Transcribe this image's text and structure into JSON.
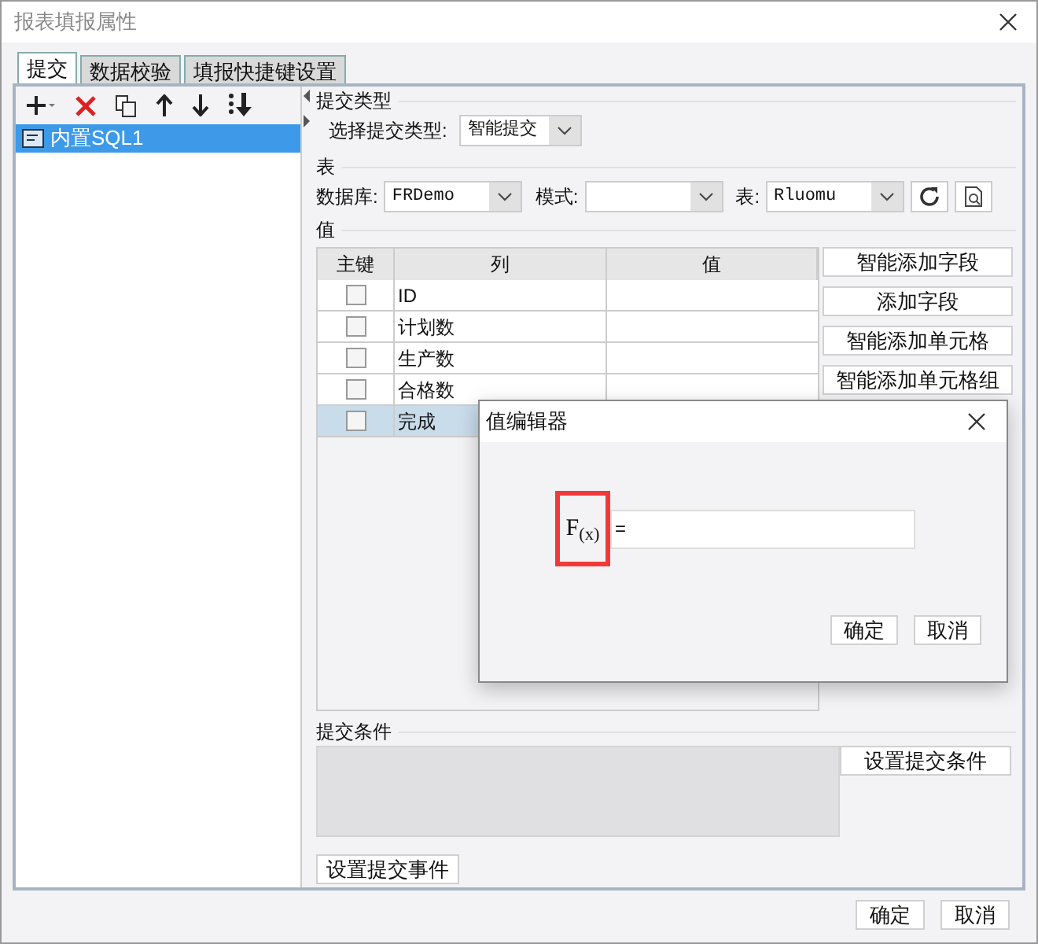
{
  "window": {
    "title": "报表填报属性"
  },
  "tabs": [
    {
      "label": "提交",
      "selected": true
    },
    {
      "label": "数据校验",
      "selected": false
    },
    {
      "label": "填报快捷键设置",
      "selected": false
    }
  ],
  "submit_list": [
    {
      "label": "内置SQL1",
      "selected": true
    }
  ],
  "submit_type": {
    "heading": "提交类型",
    "label": "选择提交类型:",
    "value": "智能提交"
  },
  "table_section": {
    "heading": "表",
    "database_label": "数据库:",
    "database": "FRDemo",
    "schema_label": "模式:",
    "table_label": "表:",
    "table": "Rluomu"
  },
  "values_section": {
    "heading": "值",
    "columns": [
      "主键",
      "列",
      "值"
    ],
    "rows": [
      {
        "checked": false,
        "column": "ID",
        "selected": false
      },
      {
        "checked": false,
        "column": "计划数",
        "selected": false
      },
      {
        "checked": false,
        "column": "生产数",
        "selected": false
      },
      {
        "checked": false,
        "column": "合格数",
        "selected": false
      },
      {
        "checked": false,
        "column": "完成",
        "selected": true
      }
    ],
    "buttons": [
      "智能添加字段",
      "添加字段",
      "智能添加单元格",
      "智能添加单元格组"
    ]
  },
  "condition": {
    "heading": "提交条件",
    "button": "设置提交条件"
  },
  "event_button": "设置提交事件",
  "footer_buttons": [
    "确定",
    "取消"
  ],
  "value_editor": {
    "title": "值编辑器",
    "formula_button": "F$_{(x)}$",
    "highlighted": true,
    "value": "=",
    "buttons": [
      "确定",
      "取消"
    ]
  }
}
